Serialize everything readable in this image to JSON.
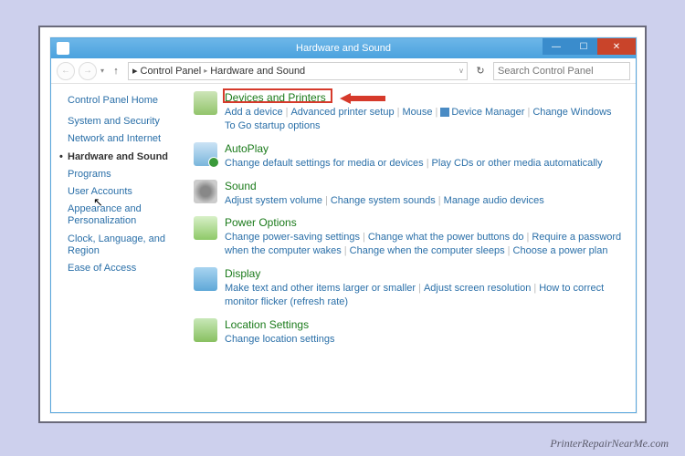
{
  "window": {
    "title": "Hardware and Sound",
    "breadcrumb": [
      "Control Panel",
      "Hardware and Sound"
    ],
    "search_placeholder": "Search Control Panel"
  },
  "sidebar": {
    "header": "Control Panel Home",
    "items": [
      "System and Security",
      "Network and Internet",
      "Hardware and Sound",
      "Programs",
      "User Accounts",
      "Appearance and Personalization",
      "Clock, Language, and Region",
      "Ease of Access"
    ],
    "current_index": 2
  },
  "categories": [
    {
      "title": "Devices and Printers",
      "highlighted": true,
      "links": [
        "Add a device",
        "Advanced printer setup",
        "Mouse",
        "Device Manager",
        "Change Windows To Go startup options"
      ],
      "special_icon_index": 3
    },
    {
      "title": "AutoPlay",
      "links": [
        "Change default settings for media or devices",
        "Play CDs or other media automatically"
      ]
    },
    {
      "title": "Sound",
      "links": [
        "Adjust system volume",
        "Change system sounds",
        "Manage audio devices"
      ]
    },
    {
      "title": "Power Options",
      "links": [
        "Change power-saving settings",
        "Change what the power buttons do",
        "Require a password when the computer wakes",
        "Change when the computer sleeps",
        "Choose a power plan"
      ]
    },
    {
      "title": "Display",
      "links": [
        "Make text and other items larger or smaller",
        "Adjust screen resolution",
        "How to correct monitor flicker (refresh rate)"
      ]
    },
    {
      "title": "Location Settings",
      "links": [
        "Change location settings"
      ]
    }
  ],
  "attribution": "PrinterRepairNearMe.com"
}
